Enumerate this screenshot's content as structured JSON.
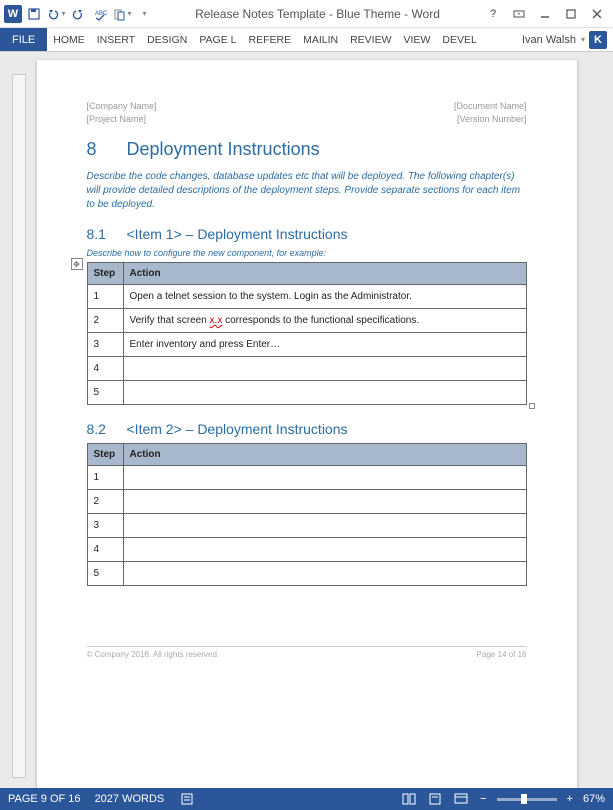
{
  "titlebar": {
    "title": "Release Notes Template - Blue Theme - Word"
  },
  "ribbon": {
    "file": "FILE",
    "tabs": [
      "HOME",
      "INSERT",
      "DESIGN",
      "PAGE L",
      "REFERE",
      "MAILIN",
      "REVIEW",
      "VIEW",
      "DEVEL"
    ],
    "user": "Ivan Walsh",
    "user_initial": "K"
  },
  "doc": {
    "header": {
      "left": [
        "[Company Name]",
        "[Project Name]"
      ],
      "right": [
        "[Document Name]",
        "[Version Number]"
      ]
    },
    "h1_num": "8",
    "h1": "Deployment Instructions",
    "intro": "Describe the code changes, database updates etc that will be deployed. The following chapter(s) will provide detailed descriptions of the deployment steps. Provide separate sections for each item to be deployed.",
    "s81_num": "8.1",
    "s81_title": "<Item 1> – Deployment Instructions",
    "s81_desc": "Describe how to configure the new component, for example:",
    "s82_num": "8.2",
    "s82_title": "<Item 2> – Deployment Instructions",
    "th_step": "Step",
    "th_action": "Action",
    "t1": {
      "r1": {
        "step": "1",
        "action_a": "Open a telnet session to the system. Login as the Administrator."
      },
      "r2": {
        "step": "2",
        "action_a": "Verify that screen ",
        "action_b": "x.x",
        "action_c": " corresponds to the functional specifications."
      },
      "r3": {
        "step": "3",
        "action_a": "Enter inventory and press Enter…"
      },
      "r4": {
        "step": "4"
      },
      "r5": {
        "step": "5"
      }
    },
    "t2": {
      "r1": {
        "step": "1"
      },
      "r2": {
        "step": "2"
      },
      "r3": {
        "step": "3"
      },
      "r4": {
        "step": "4"
      },
      "r5": {
        "step": "5"
      }
    },
    "footer": {
      "left": "© Company 2016. All rights reserved.",
      "right": "Page 14 of 16"
    }
  },
  "statusbar": {
    "page": "PAGE 9 OF 16",
    "words": "2027 WORDS",
    "zoom": "67%"
  }
}
